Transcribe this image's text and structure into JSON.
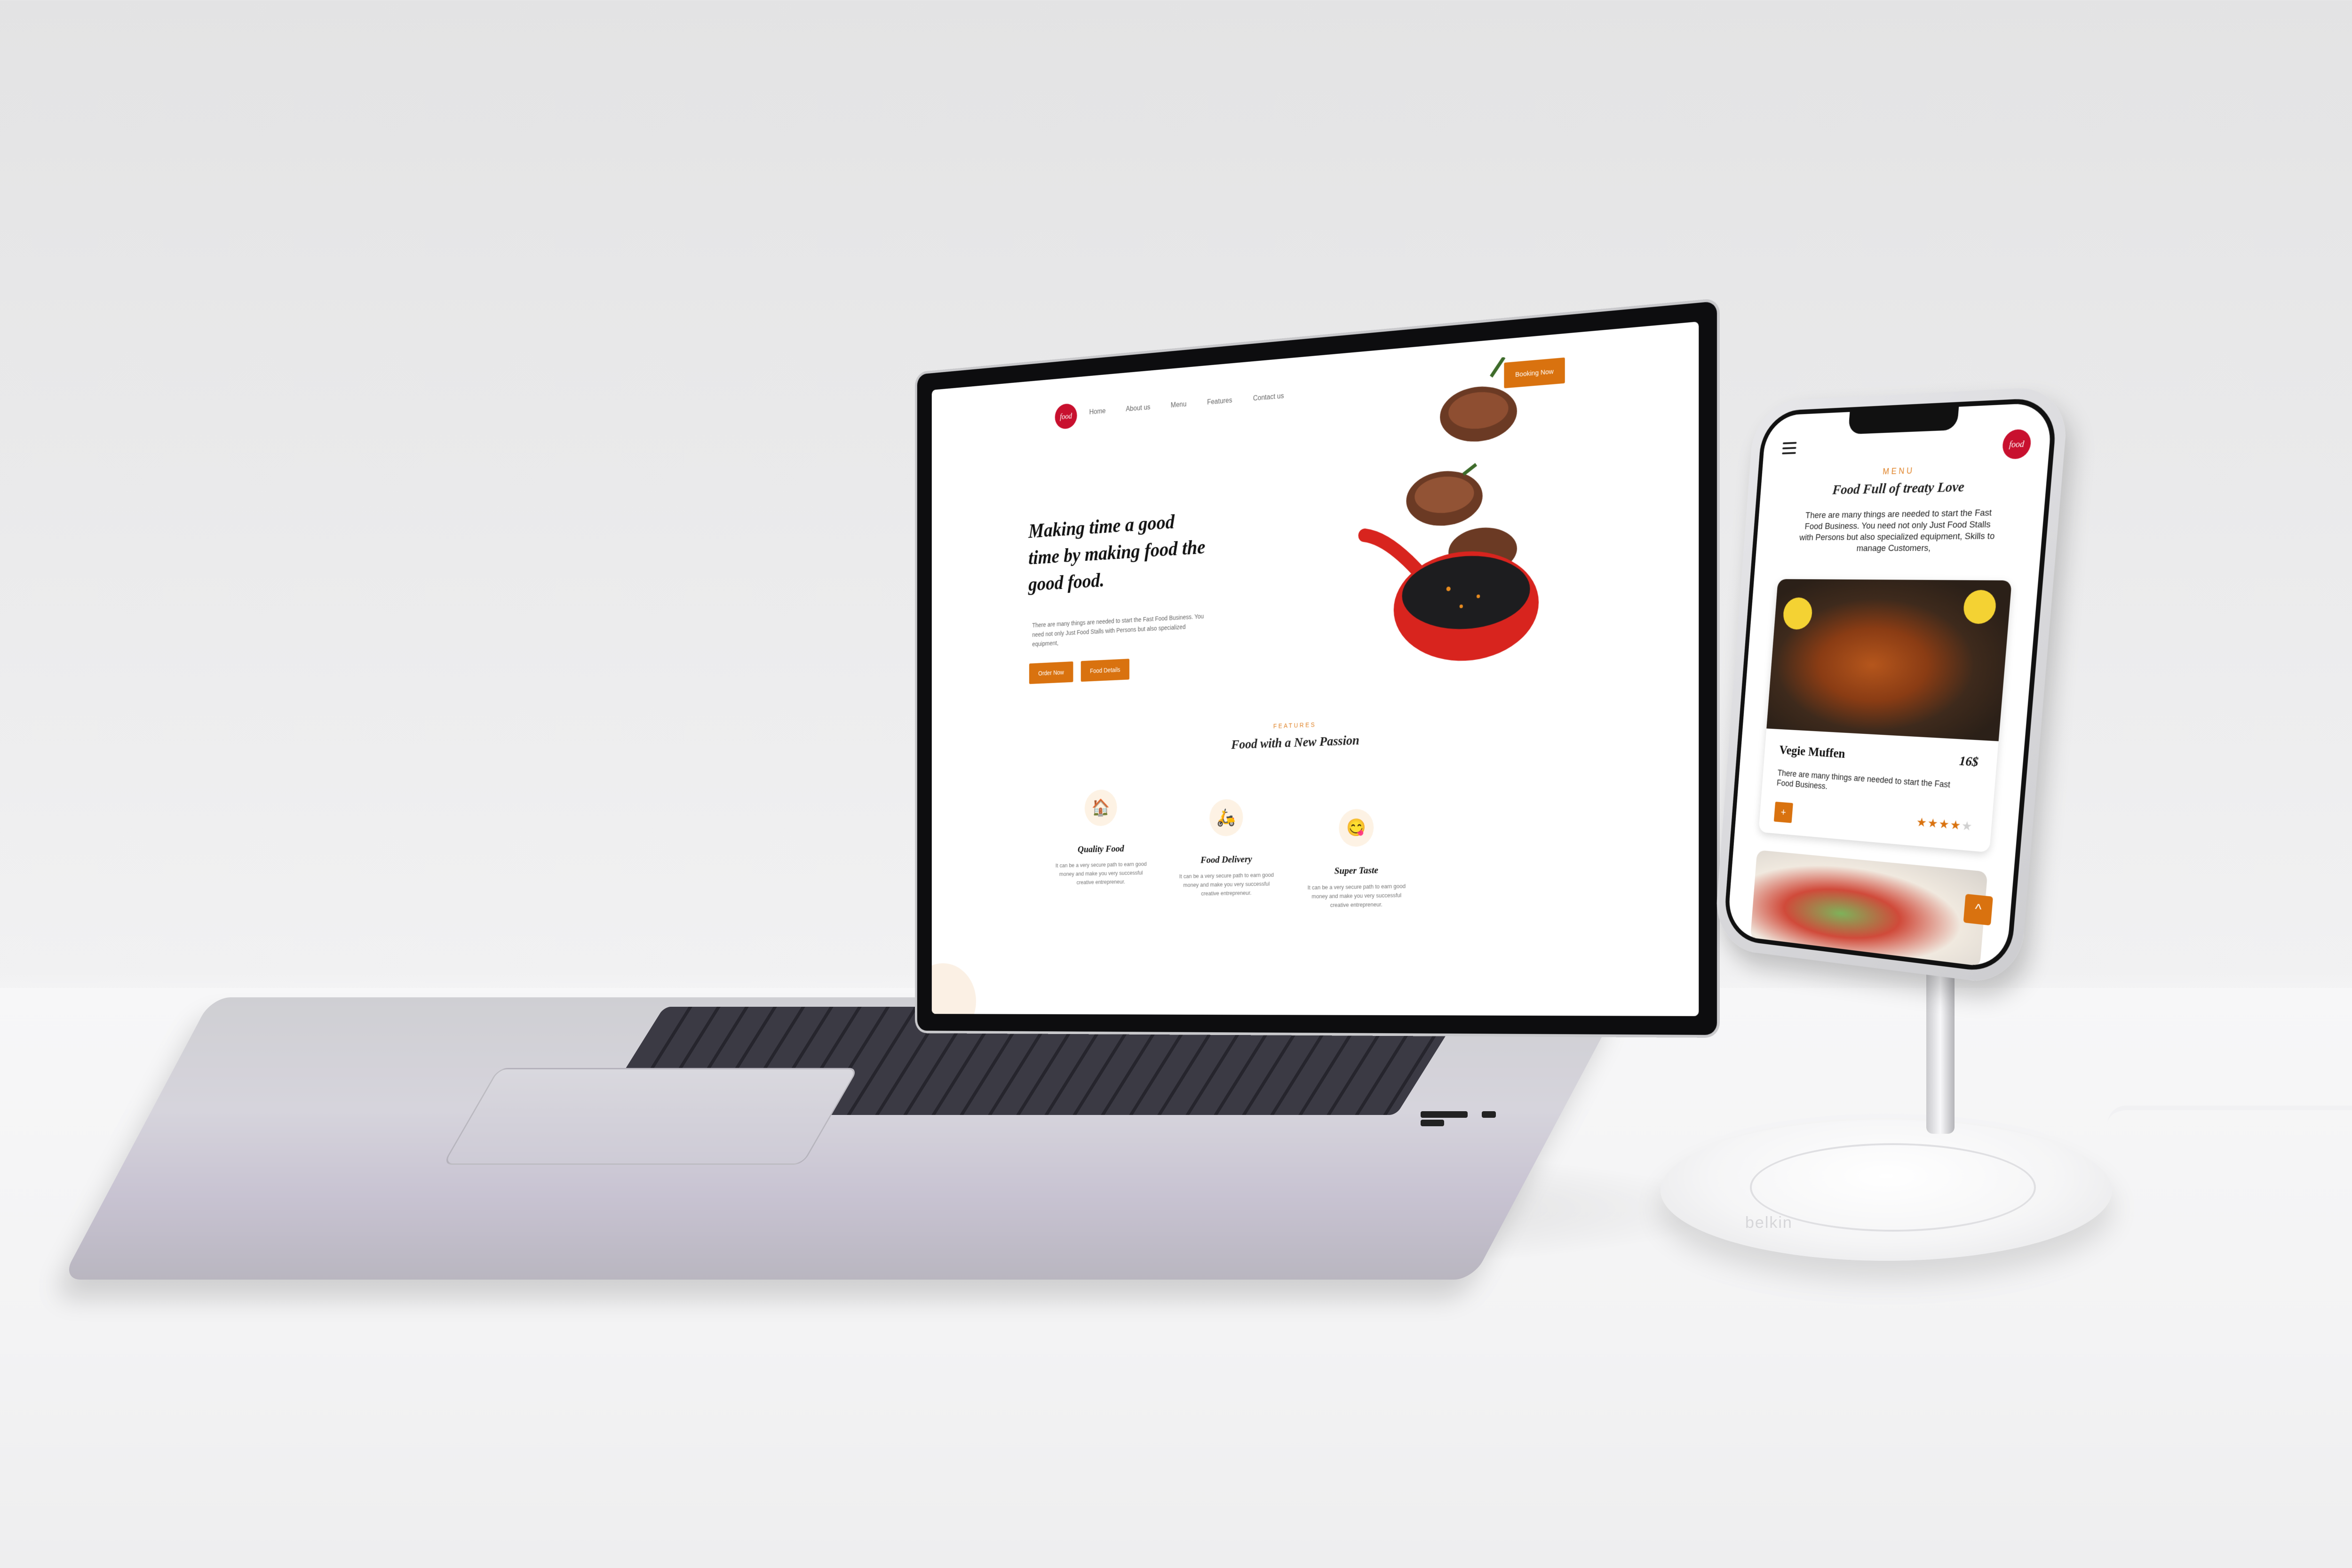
{
  "laptop_site": {
    "logo_text": "food",
    "nav": [
      "Home",
      "About us",
      "Menu",
      "Features",
      "Contact us"
    ],
    "booking_button": "Booking Now",
    "hero_title": "Making time a good time by making food the good food.",
    "hero_text": "There are many things are needed to start the Fast Food Business. You need not only Just Food Stalls with Persons but also specialized equipment,",
    "order_button": "Order Now",
    "details_button": "Food Details",
    "features_eyebrow": "FEATURES",
    "features_title": "Food with a New Passion",
    "features": [
      {
        "icon": "house-icon",
        "glyph": "🏠",
        "title": "Quality Food",
        "text": "It can be a very secure path to earn good money and make you very successful creative entrepreneur."
      },
      {
        "icon": "delivery-scooter-icon",
        "glyph": "🛵",
        "title": "Food Delivery",
        "text": "It can be a very secure path to earn good money and make you very successful creative entrepreneur."
      },
      {
        "icon": "yum-face-icon",
        "glyph": "😋",
        "title": "Super Taste",
        "text": "It can be a very secure path to earn good money and make you very successful creative entrepreneur."
      }
    ],
    "accent_color": "#d9720f",
    "logo_color": "#c8102e"
  },
  "phone_site": {
    "logo_text": "food",
    "eyebrow": "MENU",
    "title": "Food Full of treaty Love",
    "intro": "There are many things are needed to start the Fast Food Business. You need not only Just Food Stalls with Persons but also specialized equipment, Skills to manage Customers,",
    "card": {
      "name": "Vegie Muffen",
      "price": "16$",
      "text": "There are many things are needed to start the Fast Food Business.",
      "add_label": "+",
      "rating": 4,
      "rating_max": 5,
      "stars": "★★★★★"
    },
    "scroll_top_label": "^"
  },
  "stand": {
    "brand": "belkin"
  }
}
